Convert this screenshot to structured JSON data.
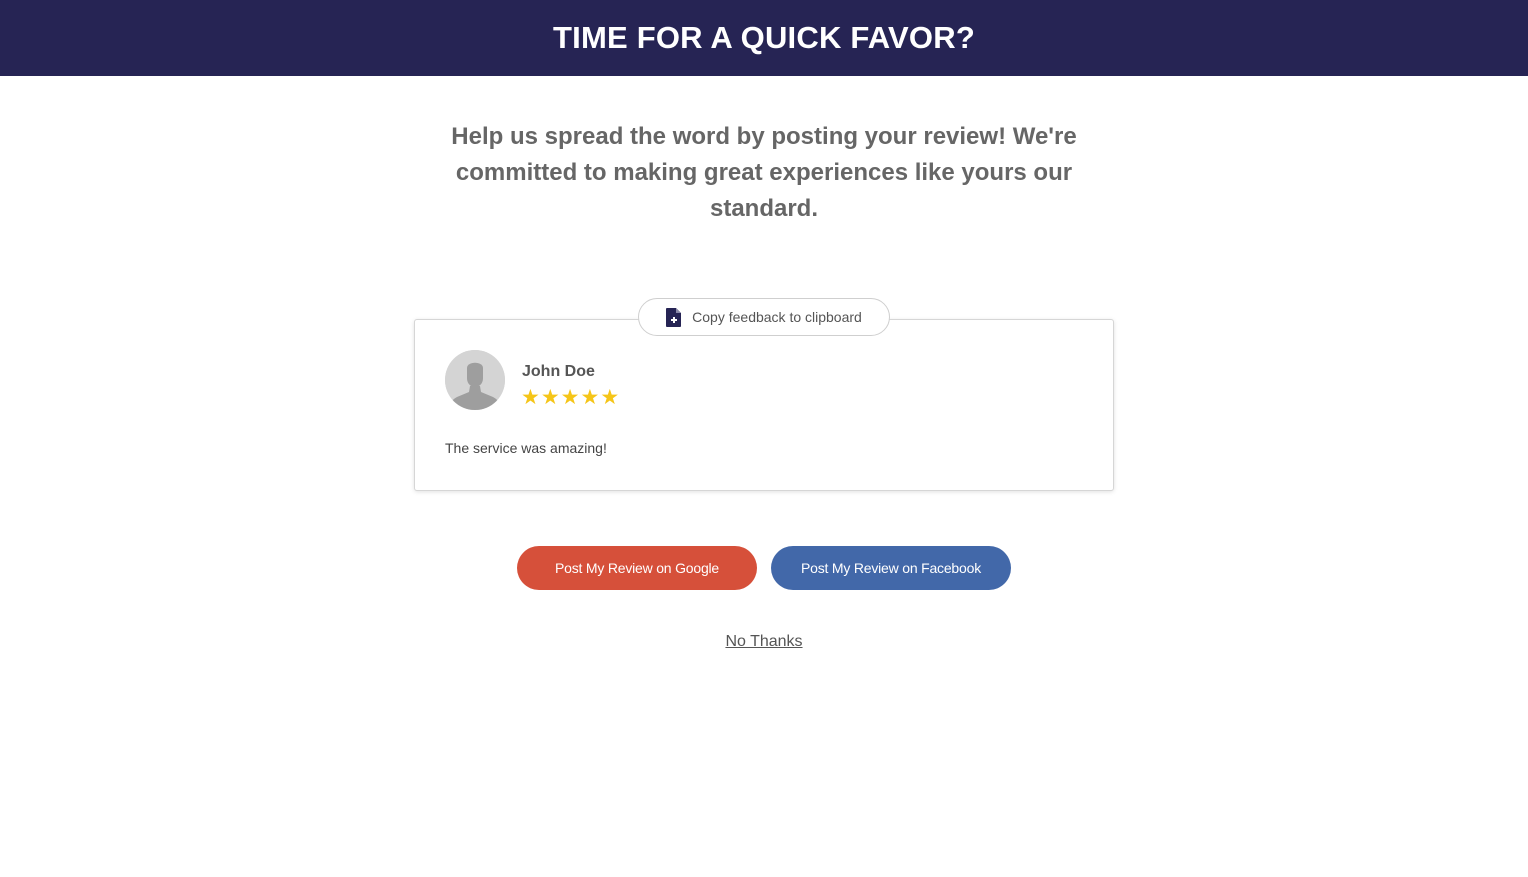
{
  "header": {
    "title": "TIME FOR A QUICK FAVOR?"
  },
  "intro": {
    "text": "Help us spread the word by posting your review! We're committed to making great experiences like yours our standard."
  },
  "review": {
    "copy_label": "Copy feedback to clipboard",
    "copy_icon": "document-plus-icon",
    "avatar_icon": "user-silhouette-icon",
    "name": "John Doe",
    "rating": 5,
    "rating_max": 5,
    "text": "The service was amazing!"
  },
  "actions": {
    "google_label": "Post My Review on Google",
    "facebook_label": "Post My Review on Facebook",
    "no_thanks_label": "No Thanks"
  },
  "colors": {
    "header_bg": "#262454",
    "google": "#d6503a",
    "facebook": "#4268a9",
    "star": "#f5c518"
  }
}
